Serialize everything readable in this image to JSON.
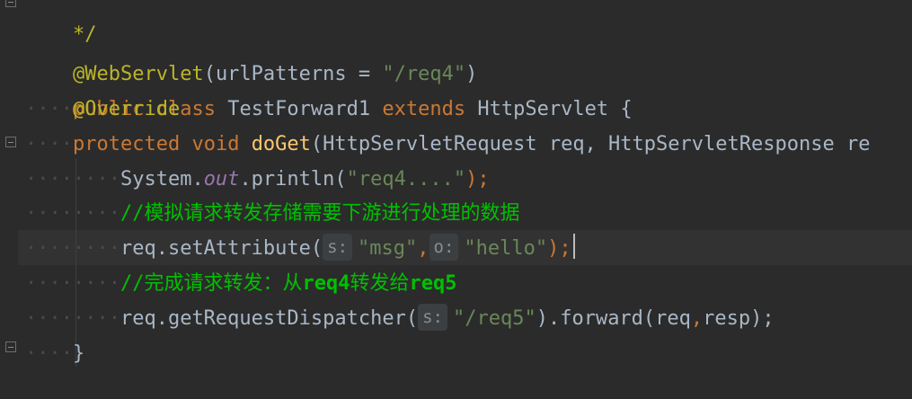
{
  "code": {
    "line0": {
      "text": "*/"
    },
    "line1": {
      "annotation": "@WebServlet",
      "paren_open": "(",
      "param": "urlPatterns",
      "assign": " = ",
      "value": "\"/req4\"",
      "paren_close": ")"
    },
    "line2": {
      "public": "public",
      "class": "class",
      "name": "TestForward1",
      "extends": "extends",
      "parent": "HttpServlet",
      "brace": "{"
    },
    "line3": {
      "annotation": "@Override"
    },
    "line4": {
      "protected": "protected",
      "void": "void",
      "method": "doGet",
      "signature": "(HttpServletRequest req, HttpServletResponse re"
    },
    "line5": {
      "system": "System.",
      "out": "out",
      "println": ".println(",
      "arg": "\"req4....\"",
      "end": ");"
    },
    "line6": {
      "comment": "//模拟请求转发存储需要下游进行处理的数据"
    },
    "line7": {
      "call": "req.setAttribute(",
      "hint1": "s:",
      "arg1": "\"msg\"",
      "comma": ",",
      "hint2": "o:",
      "arg2": "\"hello\"",
      "end": ");"
    },
    "line8": {
      "comment_start": "//完成请求转发：从",
      "comment_bold": "req4",
      "comment_mid": "转发给",
      "comment_bold2": "req5"
    },
    "line9": {
      "call": "req.getRequestDispatcher(",
      "hint": "s:",
      "arg": "\"/req5\"",
      "forward": ").forward(req",
      "comma": ",",
      "resp": "resp);"
    },
    "line10": {
      "brace": "}"
    }
  }
}
